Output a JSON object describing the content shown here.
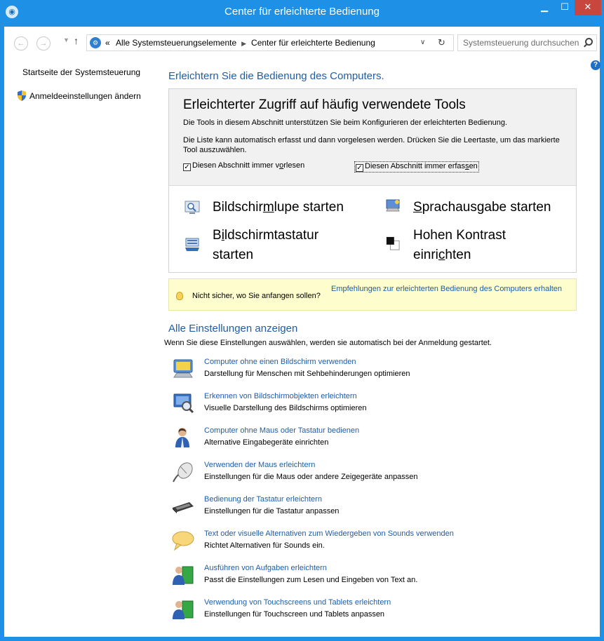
{
  "window": {
    "title": "Center für erleichterte Bedienung",
    "accent": "#1e90e6",
    "close_color": "#c7463e"
  },
  "address": {
    "overflow": "«",
    "crumb1": "Alle Systemsteuerungselemente",
    "crumb2": "Center für erleichterte Bedienung",
    "search_placeholder": "Systemsteuerung durchsuchen"
  },
  "leftnav": {
    "items": [
      {
        "label": "Startseite der Systemsteuerung"
      },
      {
        "label": "Anmeldeeinstellungen ändern"
      }
    ]
  },
  "main": {
    "heading": "Erleichtern Sie die Bedienung des Computers.",
    "tools": {
      "title": "Erleichterter Zugriff auf häufig verwendete Tools",
      "desc1": "Die Tools in diesem Abschnitt unterstützen Sie beim Konfigurieren der erleichterten Bedienung.",
      "desc2": "Die Liste kann automatisch erfasst und dann vorgelesen werden. Drücken Sie die Leertaste, um das markierte Tool auszuwählen.",
      "checkbox_read": {
        "label_a": "Diesen Abschnitt immer v",
        "label_u": "o",
        "label_b": "rlesen",
        "checked": true
      },
      "checkbox_scan": {
        "label_a": "Diesen Abschnitt immer erfas",
        "label_u": "s",
        "label_b": "en",
        "checked": true
      },
      "magnifier": {
        "a": "Bildschir",
        "u": "m",
        "b": "lupe starten"
      },
      "narrator": {
        "a": "",
        "u": "S",
        "b": "prachausgabe starten"
      },
      "keyboard": {
        "a": "B",
        "u": "i",
        "b": "ldschirmtastatur",
        "line2": "starten"
      },
      "contrast": {
        "line1": "Hohen Kontrast",
        "a": "einri",
        "u": "c",
        "b": "hten"
      }
    },
    "tip": {
      "question": "Nicht sicher, wo Sie anfangen sollen?",
      "link": "Empfehlungen zur erleichterten Bedienung des Computers erhalten"
    },
    "all_settings": {
      "title": "Alle Einstellungen anzeigen",
      "desc": "Wenn Sie diese Einstellungen auswählen, werden sie automatisch bei der Anmeldung gestartet.",
      "items": [
        {
          "title": "Computer ohne einen Bildschirm verwenden",
          "desc": "Darstellung für Menschen mit Sehbehinderungen optimieren",
          "icon": "monitor-speaker-icon"
        },
        {
          "title": "Erkennen von Bildschirmobjekten erleichtern",
          "desc": "Visuelle Darstellung des Bildschirms optimieren",
          "icon": "monitor-magnifier-icon"
        },
        {
          "title": "Computer ohne Maus oder Tastatur bedienen",
          "desc": "Alternative Eingabegeräte einrichten",
          "icon": "person-icon"
        },
        {
          "title": "Verwenden der Maus erleichtern",
          "desc": "Einstellungen für die Maus oder andere Zeigegeräte anpassen",
          "icon": "mouse-icon"
        },
        {
          "title": "Bedienung der Tastatur erleichtern",
          "desc": "Einstellungen für die Tastatur anpassen",
          "icon": "keyboard-icon"
        },
        {
          "title": "Text oder visuelle Alternativen zum Wiedergeben von Sounds verwenden",
          "desc": "Richtet Alternativen für Sounds ein.",
          "icon": "speech-bubble-icon"
        },
        {
          "title": "Ausführen von Aufgaben erleichtern",
          "desc": "Passt die Einstellungen zum Lesen und Eingeben von Text an.",
          "icon": "person-book-icon"
        },
        {
          "title": "Verwendung von Touchscreens und Tablets erleichtern",
          "desc": "Einstellungen für Touchscreen und Tablets anpassen",
          "icon": "person-tablet-icon"
        }
      ]
    }
  }
}
